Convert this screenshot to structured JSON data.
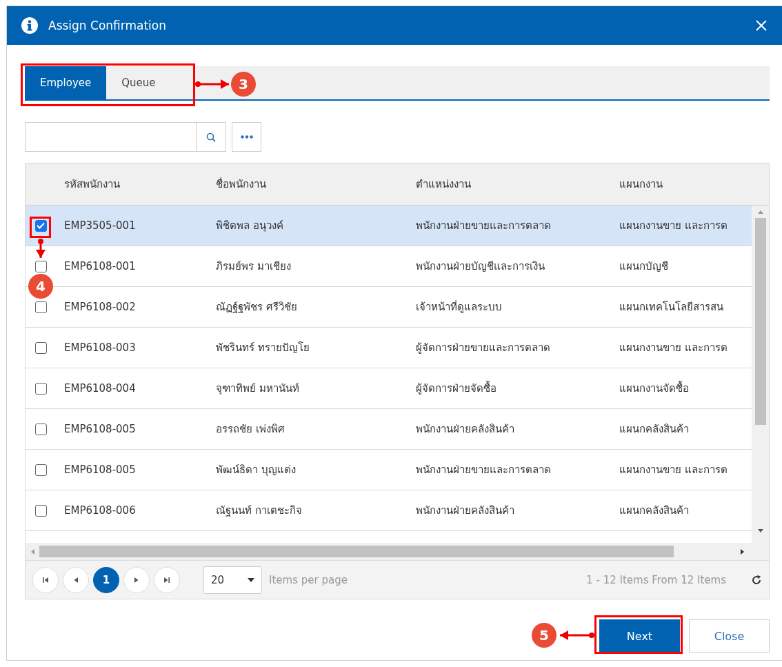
{
  "window": {
    "title": "Assign Confirmation"
  },
  "tabs": [
    {
      "label": "Employee",
      "selected": true
    },
    {
      "label": "Queue",
      "selected": false
    }
  ],
  "table": {
    "columns": [
      "รหัสพนักงาน",
      "ชื่อพนักงาน",
      "ตำแหน่งงาน",
      "แผนกงาน"
    ],
    "rows": [
      {
        "checked": true,
        "selected": true,
        "cells": [
          "EMP3505-001",
          "พิชิตพล อนุวงค์",
          "พนักงานฝ่ายขายและการตลาด",
          "แผนกงานขาย และการต"
        ]
      },
      {
        "checked": false,
        "selected": false,
        "cells": [
          "EMP6108-001",
          "ภิรมย์พร มาเชียง",
          "พนักงานฝ่ายบัญชีและการเงิน",
          "แผนกบัญชี"
        ]
      },
      {
        "checked": false,
        "selected": false,
        "cells": [
          "EMP6108-002",
          "ณัฏฐ์ฐพัชร ศรีวิชัย",
          "เจ้าหน้าที่ดูแลระบบ",
          "แผนกเทคโนโลยีสารสน"
        ]
      },
      {
        "checked": false,
        "selected": false,
        "cells": [
          "EMP6108-003",
          "พัชรินทร์ ทรายปัญโย",
          "ผู้จัดการฝ่ายขายและการตลาด",
          "แผนกงานขาย และการต"
        ]
      },
      {
        "checked": false,
        "selected": false,
        "cells": [
          "EMP6108-004",
          "จุฑาทิพย์ มหานันท์",
          "ผู้จัดการฝ่ายจัดซื้อ",
          "แผนกงานจัดซื้อ"
        ]
      },
      {
        "checked": false,
        "selected": false,
        "cells": [
          "EMP6108-005",
          "อรรถชัย เพ่งพิศ",
          "พนักงานฝ่ายคลังสินค้า",
          "แผนกคลังสินค้า"
        ]
      },
      {
        "checked": false,
        "selected": false,
        "cells": [
          "EMP6108-005",
          "พัฒน์ธิดา บุญแต่ง",
          "พนักงานฝ่ายขายและการตลาด",
          "แผนกงานขาย และการต"
        ]
      },
      {
        "checked": false,
        "selected": false,
        "cells": [
          "EMP6108-006",
          "ณัฐนนท์ กาเตชะกิจ",
          "พนักงานฝ่ายคลังสินค้า",
          "แผนกคลังสินค้า"
        ]
      }
    ]
  },
  "pager": {
    "pages": [
      {
        "label": "1",
        "selected": true
      }
    ],
    "page_size": "20",
    "page_size_label": "Items per page",
    "summary": "1 - 12 Items From 12 Items"
  },
  "buttons": [
    {
      "label": "Next",
      "kind": "primary"
    },
    {
      "label": "Close",
      "kind": "secondary"
    }
  ],
  "annotations": [
    {
      "number": "3"
    },
    {
      "number": "4"
    },
    {
      "number": "5"
    }
  ]
}
